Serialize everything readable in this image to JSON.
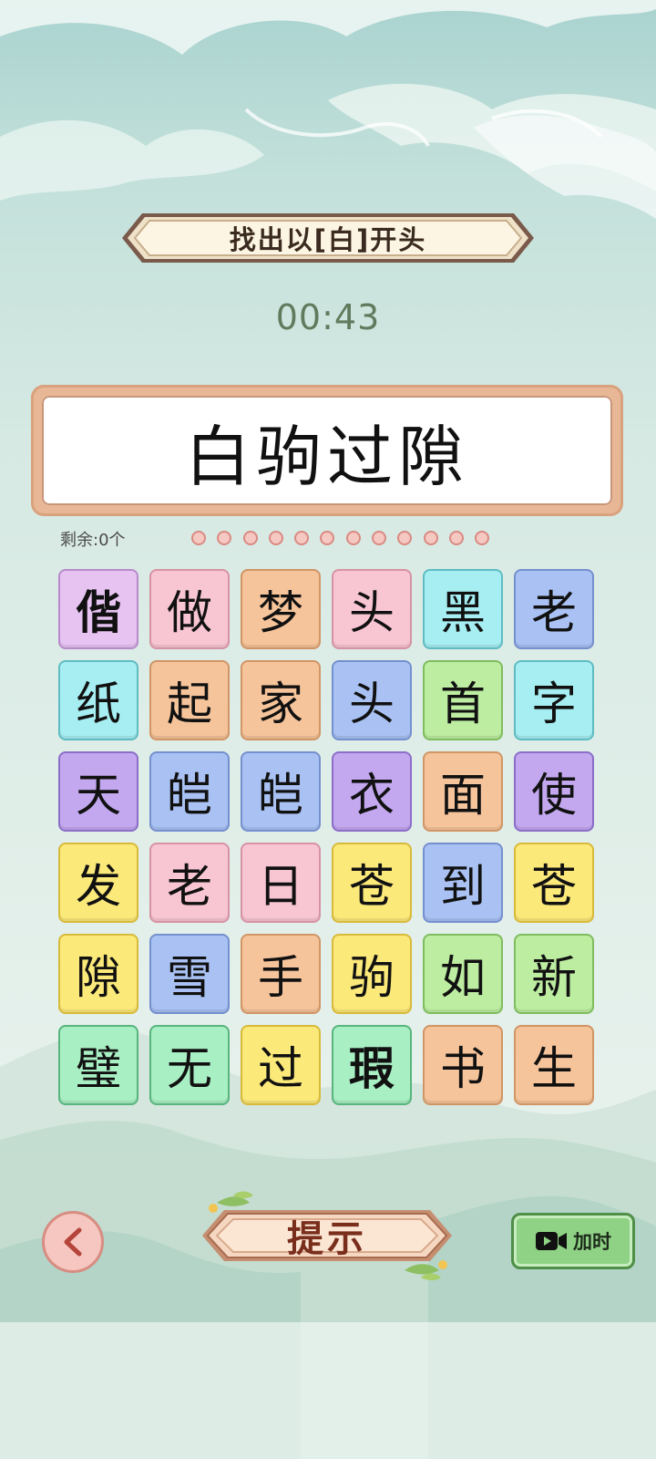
{
  "title_banner": {
    "text": "找出以[白]开头"
  },
  "timer": "00:43",
  "answer": {
    "text": "白驹过隙"
  },
  "remaining": {
    "label": "剩余:0个",
    "dot_count": 12
  },
  "grid": [
    [
      "偕",
      "做",
      "梦",
      "头",
      "黑",
      "老"
    ],
    [
      "纸",
      "起",
      "家",
      "头",
      "首",
      "字"
    ],
    [
      "天",
      "皑",
      "皑",
      "衣",
      "面",
      "使"
    ],
    [
      "发",
      "老",
      "日",
      "苍",
      "到",
      "苍"
    ],
    [
      "隙",
      "雪",
      "手",
      "驹",
      "如",
      "新"
    ],
    [
      "璧",
      "无",
      "过",
      "瑕",
      "书",
      "生"
    ]
  ],
  "grid_colors": [
    [
      "lavender",
      "pink",
      "peach",
      "pink",
      "cyan",
      "blue"
    ],
    [
      "cyan",
      "peach",
      "peach",
      "blue",
      "green",
      "cyan"
    ],
    [
      "purple",
      "blue",
      "blue",
      "purple",
      "peach",
      "purple"
    ],
    [
      "yellow",
      "pink",
      "pink",
      "yellow",
      "blue",
      "yellow"
    ],
    [
      "yellow",
      "blue",
      "peach",
      "yellow",
      "green",
      "green"
    ],
    [
      "mint",
      "mint",
      "yellow",
      "mint",
      "peach",
      "peach"
    ]
  ],
  "controls": {
    "back_icon": "chevron-left-icon",
    "hint_label": "提示",
    "add_time_icon": "video-camera-icon",
    "add_time_label": "加时"
  },
  "colors": {
    "accent_brown": "#7a2e1c",
    "frame": "#e8b896",
    "timer": "#5f7a5c"
  }
}
